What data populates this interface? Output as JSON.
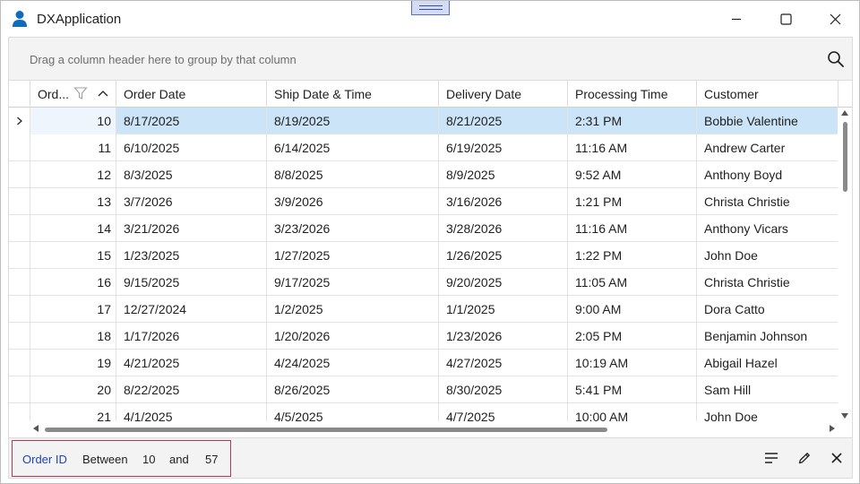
{
  "window": {
    "title": "DXApplication",
    "controls": [
      "minimize",
      "maximize",
      "close"
    ]
  },
  "group_panel": {
    "prompt": "Drag a column header here to group by that column",
    "search_icon": "search-icon"
  },
  "grid": {
    "columns": [
      {
        "label": "Ord..."
      },
      {
        "label": "Order Date"
      },
      {
        "label": "Ship Date & Time"
      },
      {
        "label": "Delivery Date"
      },
      {
        "label": "Processing Time"
      },
      {
        "label": "Customer"
      }
    ],
    "focused_row": 0,
    "rows": [
      {
        "id": "10",
        "order_date": "8/17/2025",
        "ship": "8/19/2025",
        "delivery": "8/21/2025",
        "processing": "2:31 PM",
        "customer": "Bobbie Valentine"
      },
      {
        "id": "11",
        "order_date": "6/10/2025",
        "ship": "6/14/2025",
        "delivery": "6/19/2025",
        "processing": "11:16 AM",
        "customer": "Andrew Carter"
      },
      {
        "id": "12",
        "order_date": "8/3/2025",
        "ship": "8/8/2025",
        "delivery": "8/9/2025",
        "processing": "9:52 AM",
        "customer": "Anthony Boyd"
      },
      {
        "id": "13",
        "order_date": "3/7/2026",
        "ship": "3/9/2026",
        "delivery": "3/16/2026",
        "processing": "1:21 PM",
        "customer": "Christa Christie"
      },
      {
        "id": "14",
        "order_date": "3/21/2026",
        "ship": "3/23/2026",
        "delivery": "3/28/2026",
        "processing": "11:16 AM",
        "customer": "Anthony Vicars"
      },
      {
        "id": "15",
        "order_date": "1/23/2025",
        "ship": "1/27/2025",
        "delivery": "1/26/2025",
        "processing": "1:22 PM",
        "customer": "John Doe"
      },
      {
        "id": "16",
        "order_date": "9/15/2025",
        "ship": "9/17/2025",
        "delivery": "9/20/2025",
        "processing": "11:05 AM",
        "customer": "Christa Christie"
      },
      {
        "id": "17",
        "order_date": "12/27/2024",
        "ship": "1/2/2025",
        "delivery": "1/1/2025",
        "processing": "9:00 AM",
        "customer": "Dora Catto"
      },
      {
        "id": "18",
        "order_date": "1/17/2026",
        "ship": "1/20/2026",
        "delivery": "1/23/2026",
        "processing": "2:05 PM",
        "customer": "Benjamin Johnson"
      },
      {
        "id": "19",
        "order_date": "4/21/2025",
        "ship": "4/24/2025",
        "delivery": "4/27/2025",
        "processing": "10:19 AM",
        "customer": "Abigail Hazel"
      },
      {
        "id": "20",
        "order_date": "8/22/2025",
        "ship": "8/26/2025",
        "delivery": "8/30/2025",
        "processing": "5:41 PM",
        "customer": "Sam Hill"
      },
      {
        "id": "21",
        "order_date": "4/1/2025",
        "ship": "4/5/2025",
        "delivery": "4/7/2025",
        "processing": "10:00 AM",
        "customer": "John Doe"
      }
    ]
  },
  "filter_panel": {
    "field": "Order ID",
    "operator": "Between",
    "value1": "10",
    "conjunction": "and",
    "value2": "57"
  },
  "colors": {
    "accent_selection": "#cce4f7",
    "filter_field": "#1f44b5",
    "filter_border": "#c8314b",
    "app_icon": "#0f6cbd"
  }
}
